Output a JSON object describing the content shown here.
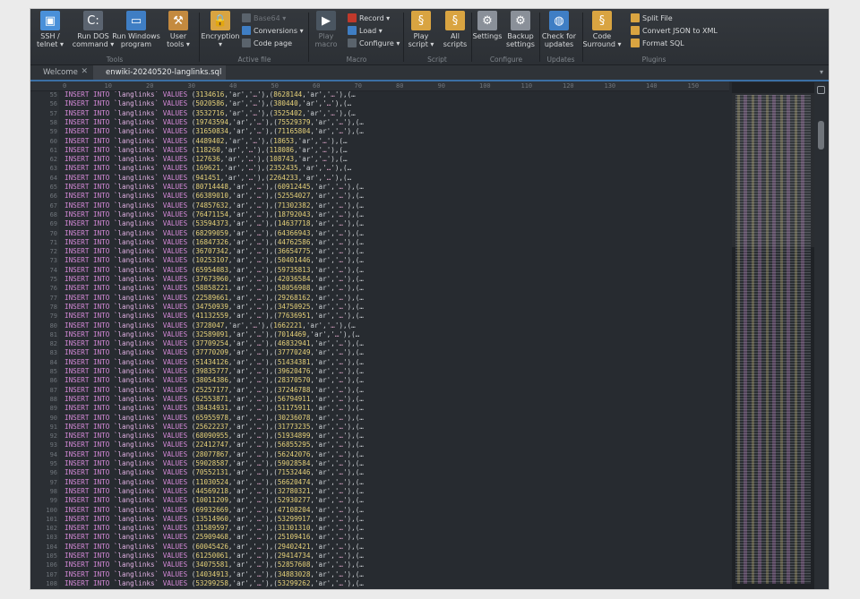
{
  "ribbon": {
    "buttons": [
      {
        "label": "SSH /\ntelnet ▾",
        "icon": "terminal-icon",
        "color": "#4a90d9"
      },
      {
        "label": "Run DOS\ncommand ▾",
        "icon": "dos-icon",
        "color": "#5b6470"
      },
      {
        "label": "Run Windows\nprogram",
        "icon": "window-icon",
        "color": "#3f7ec4"
      },
      {
        "label": "User\ntools ▾",
        "icon": "hammer-icon",
        "color": "#c48a3f"
      },
      {
        "label": "Encryption\n▾",
        "icon": "lock-icon",
        "color": "#d9a441"
      },
      {
        "label": "Play\nmacro",
        "icon": "play-macro-icon",
        "color": "#4a5560"
      },
      {
        "label": "Play\nscript ▾",
        "icon": "script-icon",
        "color": "#d9a441"
      },
      {
        "label": "All\nscripts",
        "icon": "scripts-icon",
        "color": "#d9a441"
      },
      {
        "label": "Settings",
        "icon": "gear-icon",
        "color": "#8a9099"
      },
      {
        "label": "Backup\nsettings",
        "icon": "backup-gear-icon",
        "color": "#8a9099"
      },
      {
        "label": "Check for\nupdates",
        "icon": "globe-icon",
        "color": "#3f7ec4"
      },
      {
        "label": "Code\nSurround ▾",
        "icon": "surround-icon",
        "color": "#d9a441"
      }
    ],
    "active_file": {
      "base64": "Base64 ▾",
      "conversions": "Conversions ▾",
      "code_page": "Code page"
    },
    "macro": {
      "record": "Record ▾",
      "load": "Load ▾",
      "configure": "Configure ▾"
    },
    "plugins": {
      "split_file": "Split File",
      "convert_json": "Convert JSON to XML",
      "format_sql": "Format SQL"
    },
    "groups": {
      "tools": "Tools",
      "active_file": "Active file",
      "macro": "Macro",
      "script": "Script",
      "configure": "Configure",
      "updates": "Updates",
      "plugins": "Plugins"
    }
  },
  "tabs": [
    {
      "label": "Welcome",
      "active": false
    },
    {
      "label": "enwiki-20240520-langlinks.sql",
      "active": true
    }
  ],
  "ruler": {
    "ticks": [
      "0",
      "10",
      "20",
      "30",
      "40",
      "50",
      "60",
      "70",
      "80",
      "90",
      "100",
      "110",
      "120",
      "130",
      "140",
      "150"
    ]
  },
  "editor": {
    "first_line": 55,
    "keyword_insert": "INSERT",
    "keyword_into": "INTO",
    "table": "`langlinks`",
    "keyword_values": "VALUES",
    "rows": [
      {
        "id": "3134616",
        "next": "8628144"
      },
      {
        "id": "5020586",
        "next": "380440"
      },
      {
        "id": "3532716",
        "next": "3525402"
      },
      {
        "id": "19743594",
        "next": "75529379"
      },
      {
        "id": "31650834",
        "next": "71165804"
      },
      {
        "id": "4489402",
        "next": "18653"
      },
      {
        "id": "118260",
        "next": "118086"
      },
      {
        "id": "127636",
        "next": "108743"
      },
      {
        "id": "169621",
        "next": "2352435"
      },
      {
        "id": "941451",
        "next": "2264233"
      },
      {
        "id": "80714448",
        "next": "60912445"
      },
      {
        "id": "66389010",
        "next": "52554027"
      },
      {
        "id": "74857632",
        "next": "71302382"
      },
      {
        "id": "76471154",
        "next": "18792043"
      },
      {
        "id": "53594373",
        "next": "14637718"
      },
      {
        "id": "68299059",
        "next": "64366943"
      },
      {
        "id": "16847326",
        "next": "44762586"
      },
      {
        "id": "36707342",
        "next": "36654775"
      },
      {
        "id": "10253107",
        "next": "50401446"
      },
      {
        "id": "65954083",
        "next": "59735813"
      },
      {
        "id": "37673960",
        "next": "42036584"
      },
      {
        "id": "58858221",
        "next": "58056908"
      },
      {
        "id": "22589661",
        "next": "29268162"
      },
      {
        "id": "34750939",
        "next": "34750925"
      },
      {
        "id": "41132559",
        "next": "77636951"
      },
      {
        "id": "3728047",
        "next": "1662221"
      },
      {
        "id": "32589091",
        "next": "7014469"
      },
      {
        "id": "37709254",
        "next": "46832941"
      },
      {
        "id": "37770209",
        "next": "37770249"
      },
      {
        "id": "51434126",
        "next": "51434381"
      },
      {
        "id": "39835777",
        "next": "39620476"
      },
      {
        "id": "38054386",
        "next": "28370570"
      },
      {
        "id": "25257177",
        "next": "37246788"
      },
      {
        "id": "62553871",
        "next": "56794911"
      },
      {
        "id": "38434931",
        "next": "51175911"
      },
      {
        "id": "65955978",
        "next": "30236078"
      },
      {
        "id": "25622237",
        "next": "31773235"
      },
      {
        "id": "68090955",
        "next": "51934899"
      },
      {
        "id": "22412747",
        "next": "56855295"
      },
      {
        "id": "28077867",
        "next": "56242076"
      },
      {
        "id": "59028587",
        "next": "59028584"
      },
      {
        "id": "70552131",
        "next": "71532446"
      },
      {
        "id": "11030524",
        "next": "56620474"
      },
      {
        "id": "44569218",
        "next": "32780321"
      },
      {
        "id": "10011209",
        "next": "52930277"
      },
      {
        "id": "69932669",
        "next": "47108204"
      },
      {
        "id": "13514960",
        "next": "53299917"
      },
      {
        "id": "31589597",
        "next": "31301310"
      },
      {
        "id": "25909468",
        "next": "25109416"
      },
      {
        "id": "60045426",
        "next": "29402421"
      },
      {
        "id": "61250061",
        "next": "29414734"
      },
      {
        "id": "34075581",
        "next": "52857608"
      },
      {
        "id": "14034913",
        "next": "34883028"
      },
      {
        "id": "53299258",
        "next": "53299262"
      }
    ]
  }
}
